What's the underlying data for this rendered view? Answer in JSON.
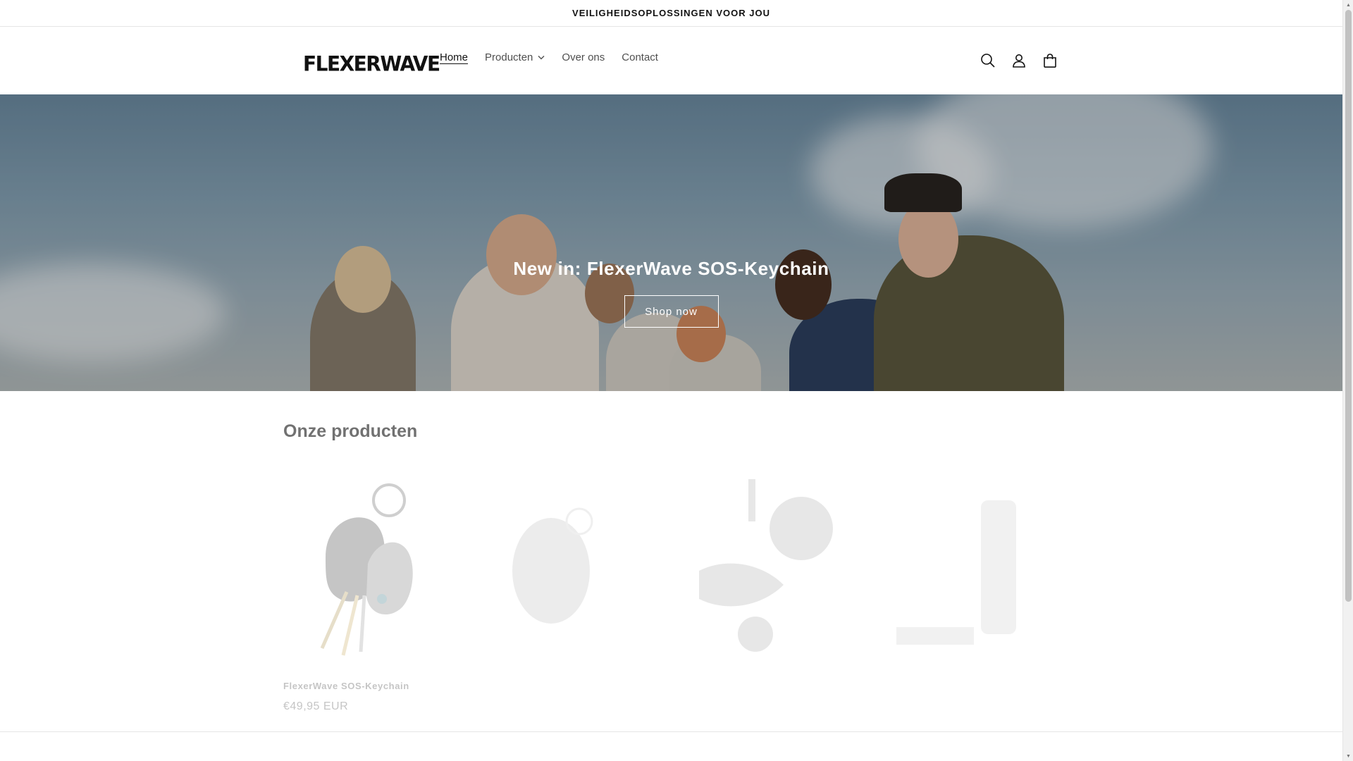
{
  "announcement": {
    "text": "VEILIGHEIDSOPLOSSINGEN VOOR JOU"
  },
  "header": {
    "logo": "FLEXERWAVE",
    "nav": [
      {
        "label": "Home",
        "active": true
      },
      {
        "label": "Producten",
        "has_dropdown": true
      },
      {
        "label": "Over ons"
      },
      {
        "label": "Contact"
      }
    ],
    "icons": [
      "search-icon",
      "account-icon",
      "cart-icon"
    ]
  },
  "hero": {
    "title": "New in: FlexerWave SOS-Keychain",
    "button_label": "Shop now"
  },
  "products_section": {
    "title": "Onze producten",
    "products": [
      {
        "title": "FlexerWave SOS-Keychain",
        "price": "€49,95 EUR"
      }
    ]
  },
  "colors": {
    "text": "#121212",
    "hero_sky": "#86a3b6",
    "white": "#ffffff"
  }
}
